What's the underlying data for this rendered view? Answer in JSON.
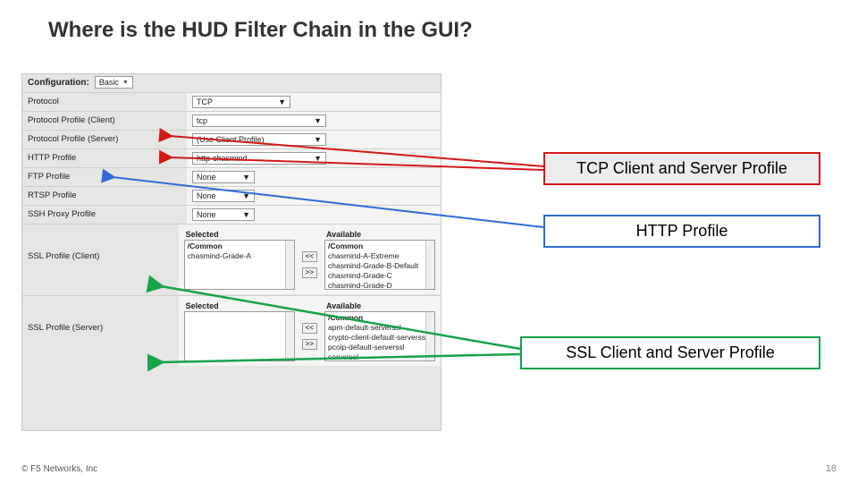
{
  "title": "Where is the HUD Filter Chain in the GUI?",
  "config": {
    "label": "Configuration:",
    "value": "Basic"
  },
  "rows": {
    "protocol": {
      "label": "Protocol",
      "value": "TCP"
    },
    "pp_client": {
      "label": "Protocol Profile (Client)",
      "value": "tcp"
    },
    "pp_server": {
      "label": "Protocol Profile (Server)",
      "value": "(Use Client Profile)"
    },
    "http": {
      "label": "HTTP Profile",
      "value": "http-chasmind"
    },
    "ftp": {
      "label": "FTP Profile",
      "value": "None"
    },
    "rtsp": {
      "label": "RTSP Profile",
      "value": "None"
    },
    "ssh": {
      "label": "SSH Proxy Profile",
      "value": "None"
    },
    "ssl_client": {
      "label": "SSL Profile (Client)"
    },
    "ssl_server": {
      "label": "SSL Profile (Server)"
    }
  },
  "lists": {
    "selected_h": "Selected",
    "available_h": "Available",
    "common": "/Common",
    "client_selected": [
      "chasmind-Grade-A"
    ],
    "client_available": [
      "chasmind-A-Extreme",
      "chasmind-Grade-B-Default",
      "chasmind-Grade-C",
      "chasmind-Grade-D"
    ],
    "server_selected": [],
    "server_available": [
      "apm-default-serverssl",
      "crypto-client-default-serverssl",
      "pcoip-default-serverssl",
      "serverssl"
    ]
  },
  "btns": {
    "left": "<<",
    "right": ">>"
  },
  "annot": {
    "tcp": "TCP Client and Server Profile",
    "http": "HTTP Profile",
    "ssl": "SSL Client and Server Profile"
  },
  "footer": {
    "left": "© F5 Networks, Inc",
    "page": "18"
  }
}
